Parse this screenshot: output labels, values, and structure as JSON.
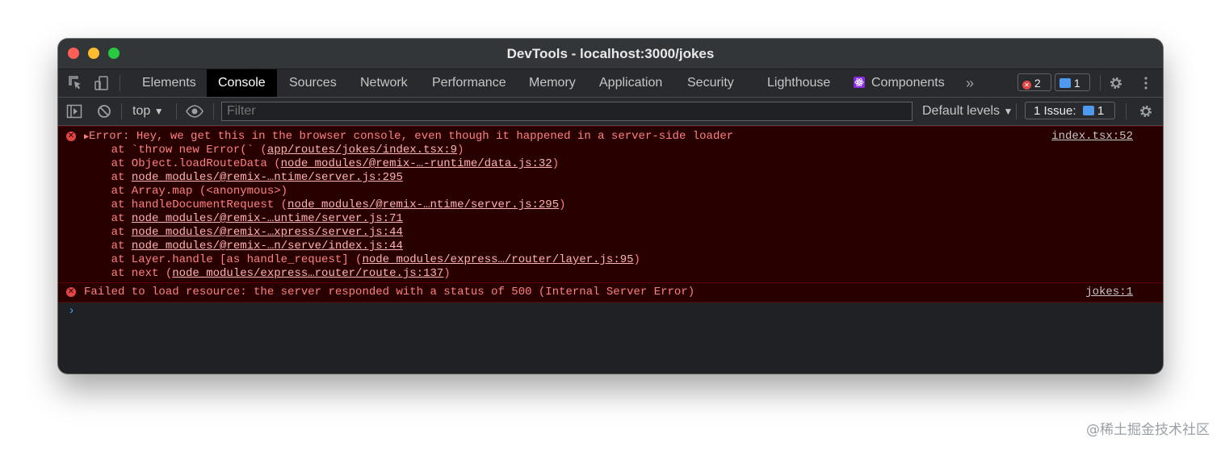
{
  "window": {
    "title": "DevTools - localhost:3000/jokes"
  },
  "tabs": [
    {
      "label": "Elements"
    },
    {
      "label": "Console"
    },
    {
      "label": "Sources"
    },
    {
      "label": "Network"
    },
    {
      "label": "Performance"
    },
    {
      "label": "Memory"
    },
    {
      "label": "Application"
    },
    {
      "label": "Security"
    },
    {
      "label": "Lighthouse"
    },
    {
      "label": "Components"
    }
  ],
  "tabbar": {
    "more": "»",
    "error_count": "2",
    "message_count": "1"
  },
  "toolbar": {
    "context": "top",
    "filter_placeholder": "Filter",
    "levels": "Default levels",
    "issues_label": "1 Issue:",
    "issues_count": "1"
  },
  "console": {
    "error1": {
      "message": "Error: Hey, we get this in the browser console, even though it happened in a server-side loader",
      "source": "index.tsx:52",
      "stack": [
        {
          "prefix": "    at `throw new Error(` (",
          "link": "app/routes/jokes/index.tsx:9",
          "suffix": ")"
        },
        {
          "prefix": "    at Object.loadRouteData (",
          "link": "node_modules/@remix-…-runtime/data.js:32",
          "suffix": ")"
        },
        {
          "prefix": "    at ",
          "link": "node_modules/@remix-…ntime/server.js:295",
          "suffix": ""
        },
        {
          "prefix": "    at Array.map (<anonymous>)",
          "link": "",
          "suffix": ""
        },
        {
          "prefix": "    at handleDocumentRequest (",
          "link": "node_modules/@remix-…ntime/server.js:295",
          "suffix": ")"
        },
        {
          "prefix": "    at ",
          "link": "node_modules/@remix-…untime/server.js:71",
          "suffix": ""
        },
        {
          "prefix": "    at ",
          "link": "node_modules/@remix-…xpress/server.js:44",
          "suffix": ""
        },
        {
          "prefix": "    at ",
          "link": "node_modules/@remix-…n/serve/index.js:44",
          "suffix": ""
        },
        {
          "prefix": "    at Layer.handle [as handle_request] (",
          "link": "node_modules/express…/router/layer.js:95",
          "suffix": ")"
        },
        {
          "prefix": "    at next (",
          "link": "node_modules/express…router/route.js:137",
          "suffix": ")"
        }
      ]
    },
    "error2": {
      "message": "Failed to load resource: the server responded with a status of 500 (Internal Server Error)",
      "source": "jokes:1"
    },
    "prompt": "›"
  },
  "watermark": "@稀土掘金技术社区",
  "colors": {
    "error_bg": "#290000",
    "error_text": "#ff8080",
    "accent": "#4e9af1"
  }
}
